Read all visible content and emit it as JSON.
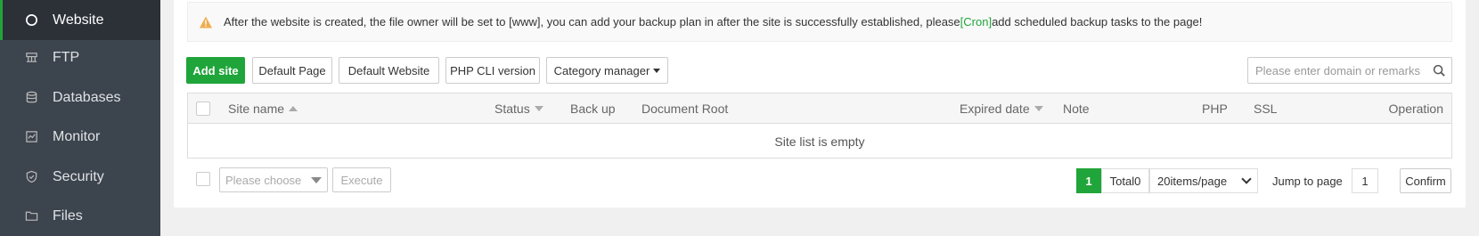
{
  "sidebar": {
    "items": [
      {
        "label": "Website",
        "icon": "circle-icon",
        "active": true
      },
      {
        "label": "FTP",
        "icon": "ftp-icon",
        "active": false
      },
      {
        "label": "Databases",
        "icon": "database-icon",
        "active": false
      },
      {
        "label": "Monitor",
        "icon": "monitor-icon",
        "active": false
      },
      {
        "label": "Security",
        "icon": "shield-icon",
        "active": false
      },
      {
        "label": "Files",
        "icon": "folder-icon",
        "active": false
      }
    ]
  },
  "notice": {
    "text_before": "After the website is created, the file owner will be set to [www], you can add your backup plan in after the site is successfully established, please",
    "link": "[Cron]",
    "text_after": "add scheduled backup tasks to the page!"
  },
  "toolbar": {
    "add_site": "Add site",
    "default_page": "Default Page",
    "default_website": "Default Website",
    "php_cli": "PHP CLI version",
    "category_manager": "Category manager"
  },
  "search": {
    "placeholder": "Please enter domain or remarks"
  },
  "table": {
    "columns": {
      "site_name": "Site name",
      "status": "Status",
      "backup": "Back up",
      "document_root": "Document Root",
      "expired_date": "Expired date",
      "note": "Note",
      "php": "PHP",
      "ssl": "SSL",
      "operation": "Operation"
    },
    "empty_text": "Site list is empty"
  },
  "batch": {
    "placeholder": "Please choose",
    "execute": "Execute"
  },
  "pagination": {
    "current_page": "1",
    "total": "Total0",
    "page_size": "20items/page",
    "jump_label": "Jump to page",
    "jump_value": "1",
    "confirm": "Confirm"
  },
  "colors": {
    "accent": "#20a53a",
    "sidebar_bg": "#3c444d",
    "warning": "#f0ad4e"
  }
}
